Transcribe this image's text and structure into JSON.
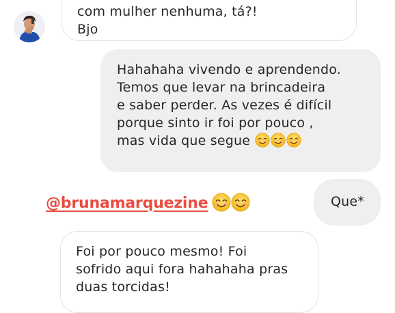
{
  "messages": [
    {
      "sender": "other",
      "lines": [
        "com mulher nenhuma, tá?!",
        "Bjo"
      ]
    },
    {
      "sender": "me",
      "lines": [
        "Hahahaha vivendo e aprendendo.",
        "Temos que levar na brincadeira",
        "e saber perder. As vezes é difícil",
        "porque sinto ir foi por pouco ,",
        "mas vida que segue"
      ],
      "trailing_emoji": [
        "smiling-face-with-smiling-eyes",
        "smiling-face-with-smiling-eyes",
        "smiling-face-with-smiling-eyes"
      ]
    },
    {
      "sender": "me",
      "lines": [
        "Que*"
      ]
    },
    {
      "sender": "other",
      "lines": [
        "Foi por pouco mesmo! Foi",
        "sofrido aqui fora hahahaha pras",
        "duas torcidas!"
      ]
    }
  ],
  "overlay": {
    "mention": "@brunamarquezine",
    "trailing_emoji": [
      "smiling-face-with-smiling-eyes",
      "smiling-face-with-smiling-eyes"
    ],
    "color": "#ea4c40"
  },
  "colors": {
    "outgoing_bubble": "#efefef",
    "incoming_border": "#e4e4e4",
    "text": "#262626"
  }
}
